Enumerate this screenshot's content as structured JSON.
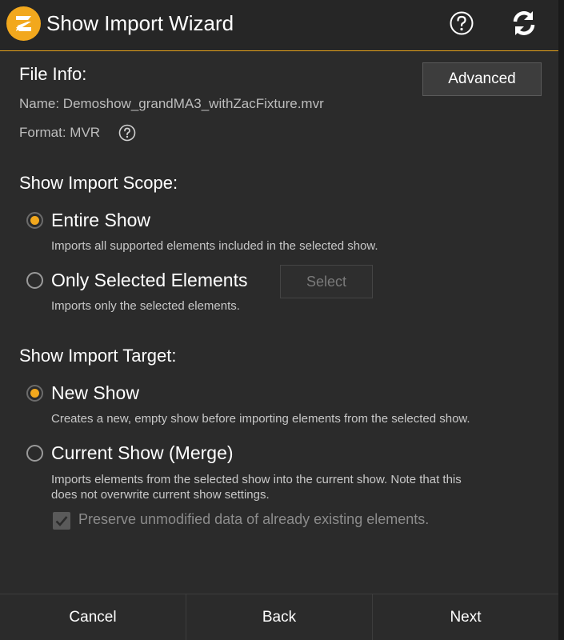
{
  "window": {
    "title": "Show Import Wizard",
    "logo_icon": "app-logo-icon",
    "accent_color": "#f2a81d"
  },
  "file_info": {
    "heading": "File Info:",
    "name_line": "Name: Demoshow_grandMA3_withZacFixture.mvr",
    "format_line": "Format: MVR",
    "advanced_label": "Advanced"
  },
  "scope": {
    "heading": "Show Import Scope:",
    "options": [
      {
        "label": "Entire Show",
        "description": "Imports all supported elements included in the selected show.",
        "selected": true
      },
      {
        "label": "Only Selected Elements",
        "description": "Imports only the selected elements.",
        "selected": false
      }
    ],
    "select_label": "Select"
  },
  "target": {
    "heading": "Show Import Target:",
    "options": [
      {
        "label": "New Show",
        "description": "Creates a new, empty show before importing elements from the selected show.",
        "selected": true
      },
      {
        "label": "Current Show (Merge)",
        "description_line1": "Imports elements from the selected show into the current show. Note that this",
        "description_line2": "does not overwrite current show settings.",
        "selected": false
      }
    ],
    "preserve_label": "Preserve unmodified data of already existing elements.",
    "preserve_checked": true
  },
  "footer": {
    "cancel": "Cancel",
    "back": "Back",
    "next": "Next"
  }
}
